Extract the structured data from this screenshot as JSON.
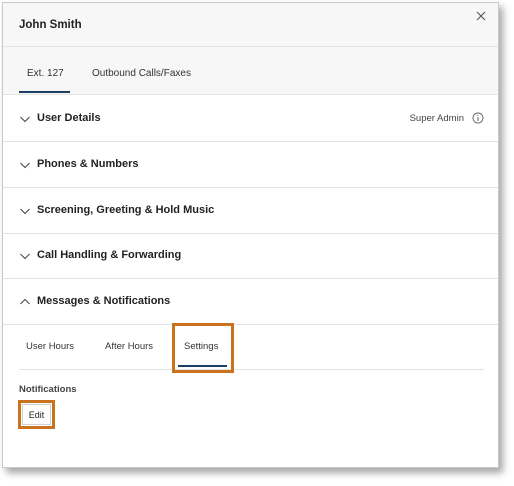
{
  "dialog": {
    "title": "John Smith"
  },
  "top_tabs": [
    {
      "label": "Ext. 127",
      "active": true
    },
    {
      "label": "Outbound Calls/Faxes",
      "active": false
    }
  ],
  "sections": [
    {
      "label": "User Details",
      "expanded": false,
      "role": "Super Admin"
    },
    {
      "label": "Phones & Numbers",
      "expanded": false
    },
    {
      "label": "Screening, Greeting & Hold Music",
      "expanded": false
    },
    {
      "label": "Call Handling & Forwarding",
      "expanded": false
    },
    {
      "label": "Messages & Notifications",
      "expanded": true
    }
  ],
  "sub_tabs": [
    {
      "label": "User Hours",
      "active": false
    },
    {
      "label": "After Hours",
      "active": false
    },
    {
      "label": "Settings",
      "active": true
    }
  ],
  "notifications": {
    "label": "Notifications",
    "edit_label": "Edit"
  },
  "colors": {
    "accent_underline": "#1b3f63",
    "highlight": "#c9731f",
    "header_bg": "#f7f7f7"
  },
  "icons": {
    "close": "close-icon",
    "collapsed": "chevron-down-icon",
    "expanded": "chevron-up-icon",
    "info": "info-icon"
  }
}
